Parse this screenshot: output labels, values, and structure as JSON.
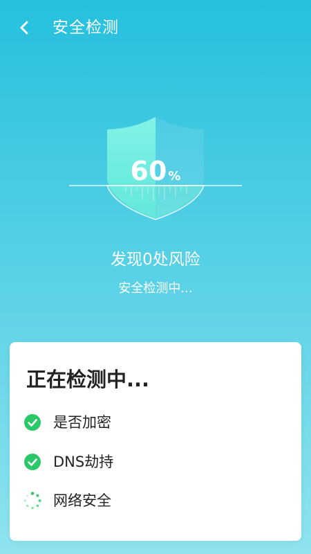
{
  "header": {
    "title": "安全检测",
    "back_icon": "chevron-left-icon"
  },
  "scan": {
    "progress_value": "60",
    "progress_unit": "%",
    "progress_fraction": 0.6,
    "risk_text": "发现0处风险",
    "status_text": "安全检测中..."
  },
  "card": {
    "title": "正在检测中...",
    "items": [
      {
        "label": "是否加密",
        "status": "done",
        "icon": "check-circle-icon"
      },
      {
        "label": "DNS劫持",
        "status": "done",
        "icon": "check-circle-icon"
      },
      {
        "label": "网络安全",
        "status": "loading",
        "icon": "loading-spinner-icon"
      }
    ]
  },
  "colors": {
    "bg_top": "#25c0de",
    "bg_bottom": "#8fe3ef",
    "shield_fill": "#7af2e3",
    "check_green": "#2bc86a",
    "text_dark": "#222222"
  }
}
